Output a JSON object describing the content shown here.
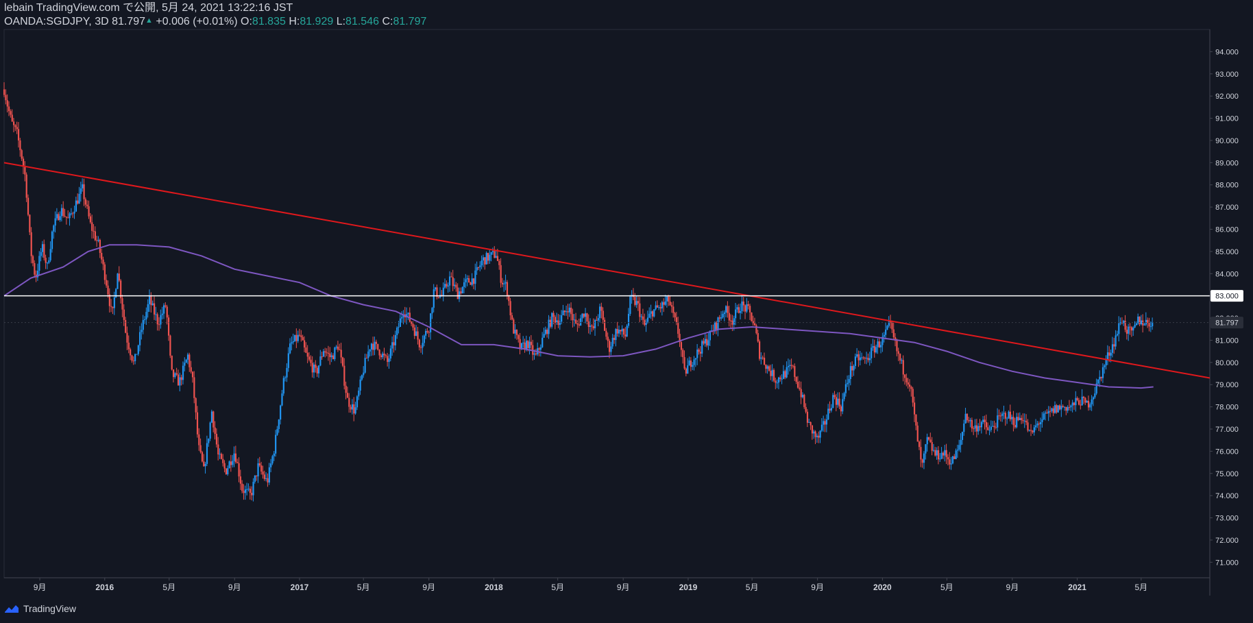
{
  "header": {
    "published": "lebain TradingView.com で公開, 5月 24, 2021 13:22:16 JST",
    "symbol": "OANDA:SGDJPY, 3D",
    "last": "81.797",
    "change": "+0.006 (+0.01%)",
    "o_label": "O:",
    "o": "81.835",
    "h_label": "H:",
    "h": "81.929",
    "l_label": "L:",
    "l": "81.546",
    "c_label": "C:",
    "c": "81.797"
  },
  "footer": {
    "brand": "TradingView"
  },
  "colors": {
    "background": "#131722",
    "up": "#2196f3",
    "down": "#ef5350",
    "trendline": "#e0181c",
    "ma": "#7e57c2",
    "level": "#ffffff",
    "axis_text": "#d1d4dc"
  },
  "chart_data": {
    "type": "candlestick",
    "symbol": "OANDA:SGDJPY",
    "interval": "3D",
    "ylim": [
      70.3,
      95.0
    ],
    "y_ticks": [
      71,
      72,
      73,
      74,
      75,
      76,
      77,
      78,
      79,
      80,
      81,
      82,
      83,
      84,
      85,
      86,
      87,
      88,
      89,
      90,
      91,
      92,
      93,
      94
    ],
    "y_tick_labels": [
      "71.000",
      "72.000",
      "73.000",
      "74.000",
      "75.000",
      "76.000",
      "77.000",
      "78.000",
      "79.000",
      "80.000",
      "81.000",
      "82.000",
      "83.000",
      "84.000",
      "85.000",
      "86.000",
      "87.000",
      "88.000",
      "89.000",
      "90.000",
      "91.000",
      "92.000",
      "93.000",
      "94.000"
    ],
    "xlim": [
      "2015-06-26",
      "2021-09-07"
    ],
    "x_ticks": [
      {
        "date": "2015-09-01",
        "label": "9月"
      },
      {
        "date": "2016-01-01",
        "label": "2016"
      },
      {
        "date": "2016-05-01",
        "label": "5月"
      },
      {
        "date": "2016-09-01",
        "label": "9月"
      },
      {
        "date": "2017-01-01",
        "label": "2017"
      },
      {
        "date": "2017-05-01",
        "label": "5月"
      },
      {
        "date": "2017-09-01",
        "label": "9月"
      },
      {
        "date": "2018-01-01",
        "label": "2018"
      },
      {
        "date": "2018-05-01",
        "label": "5月"
      },
      {
        "date": "2018-09-01",
        "label": "9月"
      },
      {
        "date": "2019-01-01",
        "label": "2019"
      },
      {
        "date": "2019-05-01",
        "label": "5月"
      },
      {
        "date": "2019-09-01",
        "label": "9月"
      },
      {
        "date": "2020-01-01",
        "label": "2020"
      },
      {
        "date": "2020-05-01",
        "label": "5月"
      },
      {
        "date": "2020-09-01",
        "label": "9月"
      },
      {
        "date": "2021-01-01",
        "label": "2021"
      },
      {
        "date": "2021-05-01",
        "label": "5月"
      }
    ],
    "price_path": [
      [
        "2015-06-26",
        92.3
      ],
      [
        "2015-07-03",
        91.5
      ],
      [
        "2015-07-10",
        90.8
      ],
      [
        "2015-07-20",
        90.3
      ],
      [
        "2015-07-28",
        89.4
      ],
      [
        "2015-08-05",
        88.3
      ],
      [
        "2015-08-15",
        85.0
      ],
      [
        "2015-08-24",
        83.8
      ],
      [
        "2015-09-05",
        85.2
      ],
      [
        "2015-09-15",
        84.3
      ],
      [
        "2015-09-25",
        86.0
      ],
      [
        "2015-10-10",
        86.9
      ],
      [
        "2015-10-25",
        86.4
      ],
      [
        "2015-11-10",
        87.3
      ],
      [
        "2015-11-20",
        87.8
      ],
      [
        "2015-12-05",
        86.2
      ],
      [
        "2015-12-20",
        85.3
      ],
      [
        "2016-01-05",
        83.5
      ],
      [
        "2016-01-15",
        82.0
      ],
      [
        "2016-01-25",
        84.2
      ],
      [
        "2016-02-10",
        81.2
      ],
      [
        "2016-02-25",
        79.9
      ],
      [
        "2016-03-10",
        81.5
      ],
      [
        "2016-03-25",
        82.8
      ],
      [
        "2016-04-10",
        81.8
      ],
      [
        "2016-04-25",
        82.6
      ],
      [
        "2016-05-05",
        79.5
      ],
      [
        "2016-05-20",
        79.1
      ],
      [
        "2016-06-05",
        80.3
      ],
      [
        "2016-06-15",
        79.0
      ],
      [
        "2016-06-25",
        76.2
      ],
      [
        "2016-07-05",
        75.1
      ],
      [
        "2016-07-20",
        77.8
      ],
      [
        "2016-08-01",
        75.8
      ],
      [
        "2016-08-15",
        75.1
      ],
      [
        "2016-09-01",
        76.0
      ],
      [
        "2016-09-15",
        74.3
      ],
      [
        "2016-10-01",
        74.0
      ],
      [
        "2016-10-15",
        75.3
      ],
      [
        "2016-11-01",
        74.6
      ],
      [
        "2016-11-15",
        76.2
      ],
      [
        "2016-12-01",
        79.0
      ],
      [
        "2016-12-15",
        80.8
      ],
      [
        "2017-01-01",
        81.2
      ],
      [
        "2017-01-15",
        80.2
      ],
      [
        "2017-02-01",
        79.5
      ],
      [
        "2017-02-15",
        80.6
      ],
      [
        "2017-03-01",
        80.2
      ],
      [
        "2017-03-15",
        80.8
      ],
      [
        "2017-04-01",
        78.3
      ],
      [
        "2017-04-15",
        77.8
      ],
      [
        "2017-05-01",
        79.7
      ],
      [
        "2017-05-15",
        80.9
      ],
      [
        "2017-06-01",
        80.5
      ],
      [
        "2017-06-15",
        80.0
      ],
      [
        "2017-07-01",
        81.2
      ],
      [
        "2017-07-15",
        82.4
      ],
      [
        "2017-08-01",
        81.7
      ],
      [
        "2017-08-15",
        80.8
      ],
      [
        "2017-09-01",
        81.6
      ],
      [
        "2017-09-10",
        83.2
      ],
      [
        "2017-09-25",
        83.0
      ],
      [
        "2017-10-10",
        83.8
      ],
      [
        "2017-10-25",
        83.1
      ],
      [
        "2017-11-10",
        83.6
      ],
      [
        "2017-11-25",
        83.8
      ],
      [
        "2017-12-10",
        84.6
      ],
      [
        "2018-01-05",
        84.9
      ],
      [
        "2018-01-15",
        83.7
      ],
      [
        "2018-01-25",
        83.4
      ],
      [
        "2018-02-05",
        81.6
      ],
      [
        "2018-02-20",
        80.6
      ],
      [
        "2018-03-05",
        80.9
      ],
      [
        "2018-03-20",
        80.2
      ],
      [
        "2018-04-05",
        81.2
      ],
      [
        "2018-04-20",
        82.0
      ],
      [
        "2018-05-05",
        81.9
      ],
      [
        "2018-05-20",
        82.5
      ],
      [
        "2018-06-05",
        81.6
      ],
      [
        "2018-06-20",
        82.3
      ],
      [
        "2018-07-05",
        81.4
      ],
      [
        "2018-07-20",
        82.4
      ],
      [
        "2018-08-05",
        80.6
      ],
      [
        "2018-08-20",
        81.5
      ],
      [
        "2018-09-05",
        81.2
      ],
      [
        "2018-09-15",
        82.9
      ],
      [
        "2018-09-28",
        82.6
      ],
      [
        "2018-10-10",
        81.6
      ],
      [
        "2018-10-25",
        82.3
      ],
      [
        "2018-11-10",
        82.5
      ],
      [
        "2018-11-25",
        82.8
      ],
      [
        "2018-12-15",
        81.2
      ],
      [
        "2018-12-25",
        79.5
      ],
      [
        "2019-01-05",
        80.0
      ],
      [
        "2019-01-20",
        80.5
      ],
      [
        "2019-02-05",
        81.0
      ],
      [
        "2019-02-20",
        81.6
      ],
      [
        "2019-03-10",
        82.4
      ],
      [
        "2019-03-25",
        81.9
      ],
      [
        "2019-04-10",
        82.6
      ],
      [
        "2019-04-25",
        82.3
      ],
      [
        "2019-05-05",
        81.7
      ],
      [
        "2019-05-15",
        80.4
      ],
      [
        "2019-06-01",
        79.7
      ],
      [
        "2019-06-15",
        79.2
      ],
      [
        "2019-07-01",
        79.5
      ],
      [
        "2019-07-15",
        79.8
      ],
      [
        "2019-08-01",
        78.6
      ],
      [
        "2019-08-15",
        77.2
      ],
      [
        "2019-09-01",
        76.5
      ],
      [
        "2019-09-15",
        77.3
      ],
      [
        "2019-10-01",
        78.5
      ],
      [
        "2019-10-15",
        78.0
      ],
      [
        "2019-11-01",
        79.6
      ],
      [
        "2019-11-15",
        80.2
      ],
      [
        "2019-12-01",
        80.1
      ],
      [
        "2019-12-15",
        80.6
      ],
      [
        "2020-01-01",
        81.0
      ],
      [
        "2020-01-15",
        81.7
      ],
      [
        "2020-01-28",
        80.5
      ],
      [
        "2020-02-10",
        79.6
      ],
      [
        "2020-02-22",
        79.0
      ],
      [
        "2020-03-05",
        76.8
      ],
      [
        "2020-03-15",
        75.2
      ],
      [
        "2020-03-25",
        76.5
      ],
      [
        "2020-04-10",
        75.8
      ],
      [
        "2020-04-25",
        75.9
      ],
      [
        "2020-05-10",
        75.5
      ],
      [
        "2020-05-25",
        76.2
      ],
      [
        "2020-06-05",
        77.7
      ],
      [
        "2020-06-20",
        77.0
      ],
      [
        "2020-07-05",
        77.3
      ],
      [
        "2020-07-20",
        76.9
      ],
      [
        "2020-08-05",
        77.4
      ],
      [
        "2020-08-20",
        77.7
      ],
      [
        "2020-09-05",
        77.3
      ],
      [
        "2020-09-20",
        77.6
      ],
      [
        "2020-10-05",
        76.7
      ],
      [
        "2020-10-20",
        77.3
      ],
      [
        "2020-11-05",
        77.6
      ],
      [
        "2020-11-20",
        77.9
      ],
      [
        "2020-12-05",
        78.0
      ],
      [
        "2020-12-20",
        78.0
      ],
      [
        "2021-01-05",
        78.3
      ],
      [
        "2021-01-20",
        78.1
      ],
      [
        "2021-02-01",
        78.6
      ],
      [
        "2021-02-15",
        79.5
      ],
      [
        "2021-03-01",
        80.4
      ],
      [
        "2021-03-12",
        81.0
      ],
      [
        "2021-03-25",
        82.0
      ],
      [
        "2021-04-05",
        81.4
      ],
      [
        "2021-04-15",
        81.3
      ],
      [
        "2021-04-25",
        81.9
      ],
      [
        "2021-05-10",
        81.8
      ],
      [
        "2021-05-22",
        81.8
      ]
    ],
    "moving_average": [
      [
        "2015-06-26",
        83.0
      ],
      [
        "2015-08-15",
        83.8
      ],
      [
        "2015-10-15",
        84.3
      ],
      [
        "2015-12-01",
        85.0
      ],
      [
        "2016-01-10",
        85.3
      ],
      [
        "2016-03-01",
        85.3
      ],
      [
        "2016-05-01",
        85.2
      ],
      [
        "2016-07-01",
        84.8
      ],
      [
        "2016-09-01",
        84.2
      ],
      [
        "2016-11-01",
        83.9
      ],
      [
        "2017-01-01",
        83.6
      ],
      [
        "2017-03-01",
        83.0
      ],
      [
        "2017-05-01",
        82.6
      ],
      [
        "2017-07-01",
        82.3
      ],
      [
        "2017-09-01",
        81.6
      ],
      [
        "2017-11-01",
        80.8
      ],
      [
        "2018-01-01",
        80.8
      ],
      [
        "2018-03-01",
        80.6
      ],
      [
        "2018-05-01",
        80.3
      ],
      [
        "2018-07-01",
        80.25
      ],
      [
        "2018-09-01",
        80.3
      ],
      [
        "2018-11-01",
        80.6
      ],
      [
        "2019-01-01",
        81.1
      ],
      [
        "2019-03-01",
        81.5
      ],
      [
        "2019-05-01",
        81.6
      ],
      [
        "2019-07-01",
        81.5
      ],
      [
        "2019-09-01",
        81.4
      ],
      [
        "2019-11-01",
        81.3
      ],
      [
        "2020-01-01",
        81.1
      ],
      [
        "2020-03-01",
        80.9
      ],
      [
        "2020-05-01",
        80.5
      ],
      [
        "2020-07-01",
        80.0
      ],
      [
        "2020-09-01",
        79.6
      ],
      [
        "2020-11-01",
        79.3
      ],
      [
        "2021-01-01",
        79.1
      ],
      [
        "2021-03-01",
        78.9
      ],
      [
        "2021-05-01",
        78.85
      ],
      [
        "2021-05-24",
        78.9
      ]
    ],
    "trendline": {
      "from": [
        "2015-06-26",
        89.0
      ],
      "to": [
        "2021-09-07",
        79.3
      ]
    },
    "horizontal_level": {
      "value": 83.0,
      "label": "83.000"
    },
    "last_price_label": "81.797",
    "last_price": 81.797
  }
}
